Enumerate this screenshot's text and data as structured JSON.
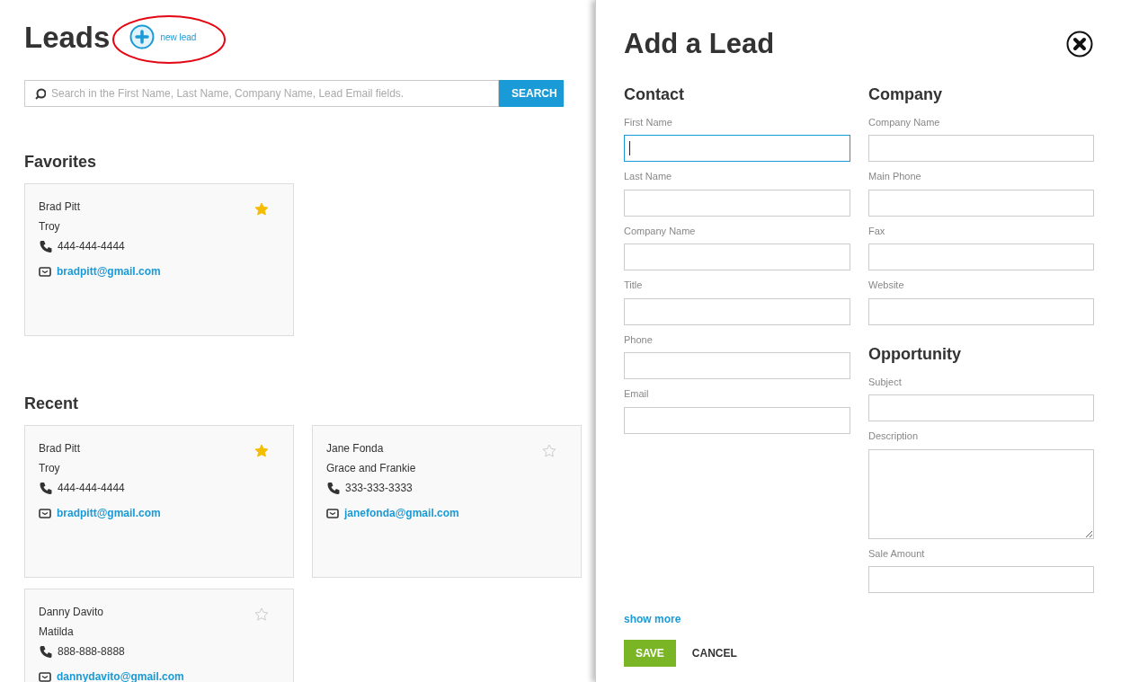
{
  "leads_page": {
    "title": "Leads",
    "new_lead_label": "new lead",
    "search": {
      "placeholder": "Search in the First Name, Last Name, Company Name, Lead Email fields.",
      "button": "SEARCH"
    },
    "favorites": {
      "heading": "Favorites",
      "cards": [
        {
          "name": "Brad Pitt",
          "company": "Troy",
          "phone": "444-444-4444",
          "email": "bradpitt@gmail.com",
          "favorite": true
        }
      ]
    },
    "recent": {
      "heading": "Recent",
      "cards": [
        {
          "name": "Brad Pitt",
          "company": "Troy",
          "phone": "444-444-4444",
          "email": "bradpitt@gmail.com",
          "favorite": true
        },
        {
          "name": "Jane Fonda",
          "company": "Grace and Frankie",
          "phone": "333-333-3333",
          "email": "janefonda@gmail.com",
          "favorite": false
        },
        {
          "name": "Danny Davito",
          "company": "Matilda",
          "phone": "888-888-8888",
          "email": "dannydavito@gmail.com",
          "favorite": false
        }
      ]
    }
  },
  "add_lead_panel": {
    "title": "Add a Lead",
    "columns": [
      {
        "sections": [
          {
            "heading": "Contact",
            "fields": [
              {
                "label": "First Name",
                "kind": "input",
                "focused": true
              },
              {
                "label": "Last Name",
                "kind": "input",
                "focused": false
              },
              {
                "label": "Company Name",
                "kind": "input",
                "focused": false
              },
              {
                "label": "Title",
                "kind": "input",
                "focused": false
              },
              {
                "label": "Phone",
                "kind": "input",
                "focused": false
              },
              {
                "label": "Email",
                "kind": "input",
                "focused": false
              }
            ]
          }
        ]
      },
      {
        "sections": [
          {
            "heading": "Company",
            "fields": [
              {
                "label": "Company Name",
                "kind": "input",
                "focused": false
              },
              {
                "label": "Main Phone",
                "kind": "input",
                "focused": false
              },
              {
                "label": "Fax",
                "kind": "input",
                "focused": false
              },
              {
                "label": "Website",
                "kind": "input",
                "focused": false
              }
            ]
          },
          {
            "heading": "Opportunity",
            "fields": [
              {
                "label": "Subject",
                "kind": "input",
                "focused": false
              },
              {
                "label": "Description",
                "kind": "textarea",
                "focused": false
              },
              {
                "label": "Sale Amount",
                "kind": "input",
                "focused": false
              }
            ]
          }
        ]
      }
    ],
    "show_more": "show more",
    "save": "SAVE",
    "cancel": "CANCEL"
  }
}
